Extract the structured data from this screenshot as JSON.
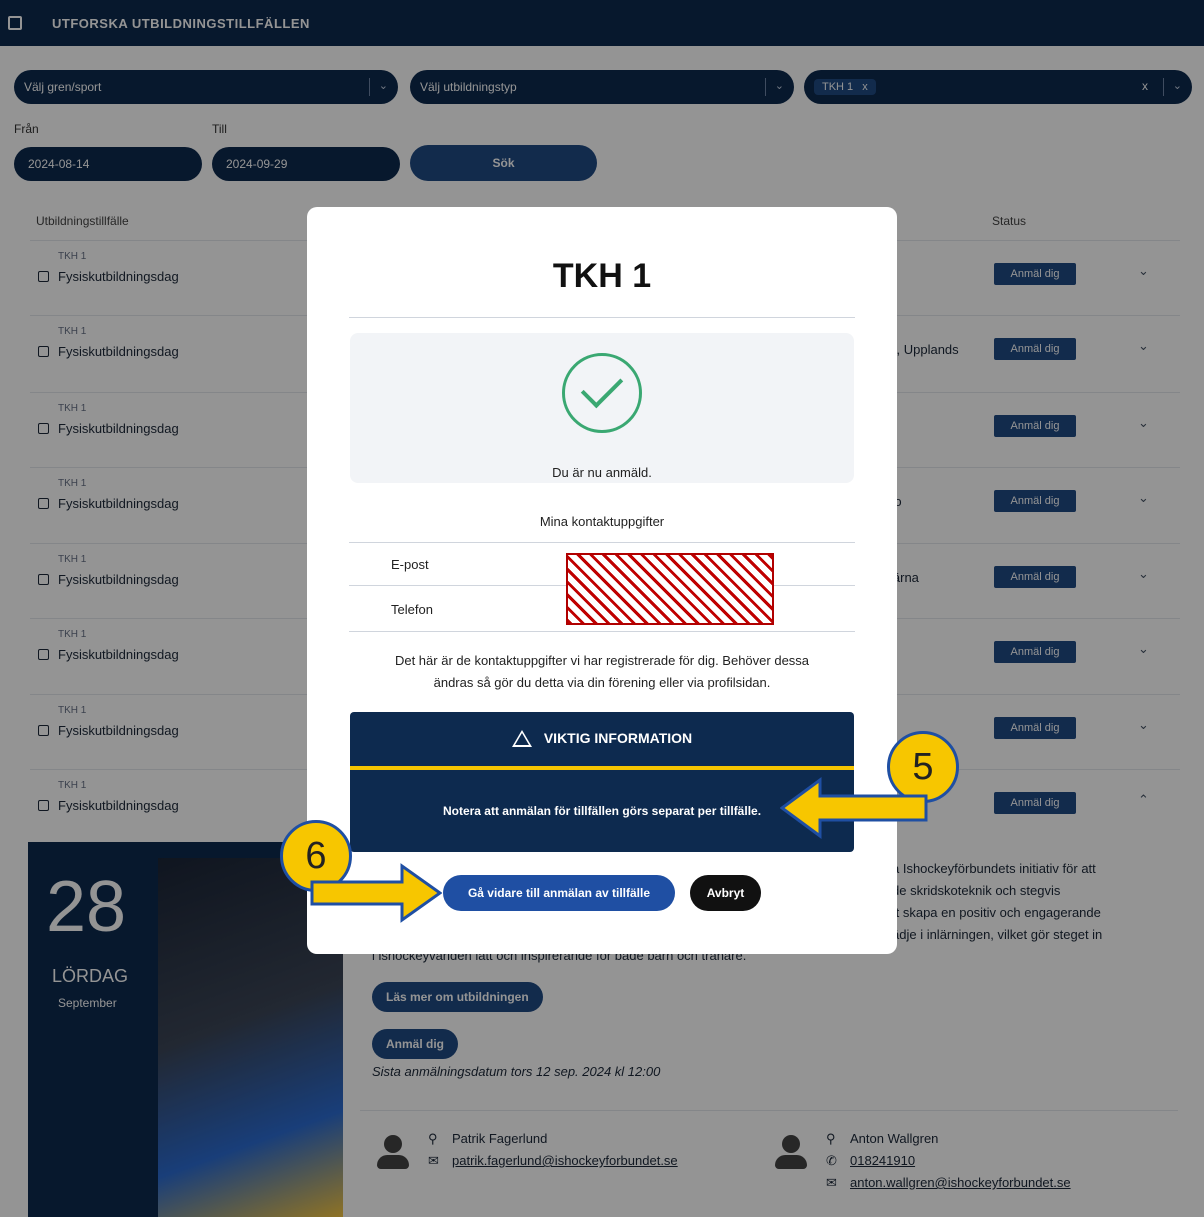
{
  "header": {
    "title": "UTFORSKA UTBILDNINGSTILLFÄLLEN"
  },
  "filters": {
    "sport_placeholder": "Välj gren/sport",
    "type_placeholder": "Välj utbildningstyp",
    "selected_chip": "TKH 1",
    "chip_remove": "x",
    "clear": "x",
    "from_label": "Från",
    "to_label": "Till",
    "from_value": "2024-08-14",
    "to_value": "2024-09-29",
    "search_label": "Sök"
  },
  "table": {
    "col_event": "Utbildningstillfälle",
    "col_status": "Status",
    "rows": [
      {
        "code": "TKH 1",
        "name": "Fysiskutbildningsdag",
        "location": "",
        "status": "Anmäl dig"
      },
      {
        "code": "TKH 1",
        "name": "Fysiskutbildningsdag",
        "location": "Il, Upplands",
        "status": "Anmäl dig"
      },
      {
        "code": "TKH 1",
        "name": "Fysiskutbildningsdag",
        "location": "",
        "status": "Anmäl dig"
      },
      {
        "code": "TKH 1",
        "name": "Fysiskutbildningsdag",
        "location": "ro",
        "status": "Anmäl dig"
      },
      {
        "code": "TKH 1",
        "name": "Fysiskutbildningsdag",
        "location": "lärna",
        "status": "Anmäl dig"
      },
      {
        "code": "TKH 1",
        "name": "Fysiskutbildningsdag",
        "location": "",
        "status": "Anmäl dig"
      },
      {
        "code": "TKH 1",
        "name": "Fysiskutbildningsdag",
        "location": "",
        "status": "Anmäl dig"
      },
      {
        "code": "TKH 1",
        "name": "Fysiskutbildningsdag",
        "location": "",
        "status": "Anmäl dig"
      }
    ]
  },
  "details": {
    "day_number": "28",
    "weekday": "LÖRDAG",
    "month": "September",
    "description_lines": [
      "a Ishockeyförbundets initiativ för att",
      "de skridskoteknik och stegvis",
      "tt skapa en positiv och engagerande",
      "ädje i inlärningen, vilket gör steget in"
    ],
    "description_tail": "i ishockeyvärlden lätt och inspirerande för både barn och tränare.",
    "read_more": "Läs mer om utbildningen",
    "register": "Anmäl dig",
    "deadline": "Sista anmälningsdatum tors 12 sep. 2024 kl 12:00",
    "contact1_name": "Patrik Fagerlund",
    "contact1_email": "patrik.fagerlund@ishockeyforbundet.se",
    "contact2_name": "Anton Wallgren",
    "contact2_phone": "018241910",
    "contact2_email": "anton.wallgren@ishockeyforbundet.se"
  },
  "modal": {
    "title": "TKH 1",
    "success_text": "Du är nu anmäld.",
    "contact_heading": "Mina kontaktuppgifter",
    "email_label": "E-post",
    "phone_label": "Telefon",
    "info_line1": "Det här är de kontaktuppgifter vi har registrerade för dig. Behöver dessa",
    "info_line2": "ändras så gör du detta via din förening eller via profilsidan.",
    "warning_title": "VIKTIG INFORMATION",
    "warning_text": "Notera att anmälan för tillfällen görs separat per tillfälle.",
    "continue_button": "Gå vidare till anmälan av tillfälle",
    "cancel_button": "Avbryt"
  },
  "annotations": {
    "step5": "5",
    "step6": "6"
  },
  "colors": {
    "navy": "#0d2a4f",
    "accent_blue": "#1f4fa3",
    "yellow": "#f7c600",
    "success_green": "#3aa872"
  }
}
